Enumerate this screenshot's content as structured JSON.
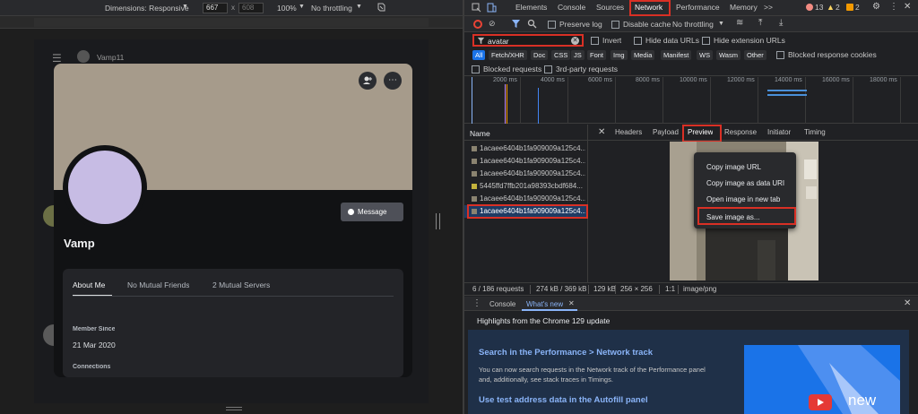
{
  "device_toolbar": {
    "dimensions_label": "Dimensions: Responsive",
    "width_value": "667",
    "times": "x",
    "height_value": "608",
    "zoom_value": "100%",
    "throttling_value": "No throttling"
  },
  "profile": {
    "header_name": "Vamp11",
    "name": "Vamp",
    "message_button": "Message",
    "tabs": [
      "About Me",
      "No Mutual Friends",
      "2 Mutual Servers"
    ],
    "member_since_label": "Member Since",
    "member_since_value": "21 Mar 2020",
    "connections_label": "Connections"
  },
  "devtools": {
    "tabs": [
      "Elements",
      "Console",
      "Sources",
      "Network",
      "Performance",
      "Memory"
    ],
    "more_tabs": ">>",
    "badges": {
      "errors": "13",
      "warnings": "2",
      "issues": "2"
    },
    "net_toolbar": {
      "preserve_log": "Preserve log",
      "disable_cache": "Disable cache",
      "throttling": "No throttling"
    },
    "filter": {
      "value": "avatar",
      "invert": "Invert",
      "hide_data_urls": "Hide data URLs",
      "hide_extension_urls": "Hide extension URLs"
    },
    "type_chips": [
      "All",
      "Fetch/XHR",
      "Doc",
      "CSS",
      "JS",
      "Font",
      "Img",
      "Media",
      "Manifest",
      "WS",
      "Wasm",
      "Other"
    ],
    "blocked_response_cookies": "Blocked response cookies",
    "blocked_requests": "Blocked requests",
    "third_party_requests": "3rd-party requests",
    "timeline_ticks": [
      "2000 ms",
      "4000 ms",
      "6000 ms",
      "8000 ms",
      "10000 ms",
      "12000 ms",
      "14000 ms",
      "16000 ms",
      "18000 ms"
    ],
    "name_header": "Name",
    "requests": [
      "1acaee6404b1fa909009a125c4...",
      "1acaee6404b1fa909009a125c4...",
      "1acaee6404b1fa909009a125c4...",
      "5445ffd7ffb201a98393cbdf684...",
      "1acaee6404b1fa909009a125c4...",
      "1acaee6404b1fa909009a125c4..."
    ],
    "detail_tabs": [
      "Headers",
      "Payload",
      "Preview",
      "Response",
      "Initiator",
      "Timing"
    ],
    "context_menu": [
      "Copy image URL",
      "Copy image as data URI",
      "Open image in new tab",
      "Save image as..."
    ],
    "status": {
      "requests": "6 / 186 requests",
      "transferred": "274 kB / 369 kB",
      "size": "129 kB",
      "dimensions": "256 × 256",
      "ratio": "1:1",
      "mime": "image/png"
    },
    "drawer": {
      "tabs": [
        "Console",
        "What's new"
      ],
      "highlights": "Highlights from the Chrome 129 update",
      "item1_title": "Search in the Performance > Network track",
      "item1_body1": "You can now search requests in the Network track of the Performance panel",
      "item1_body2": "and, additionally, see stack traces in Timings.",
      "item2_title": "Use test address data in the Autofill panel",
      "video_label": "new"
    }
  },
  "colors": {
    "highlight": "#d93025",
    "accent": "#1a73e8",
    "banner": "#a69b8b",
    "avatar": "#c7bce4"
  }
}
